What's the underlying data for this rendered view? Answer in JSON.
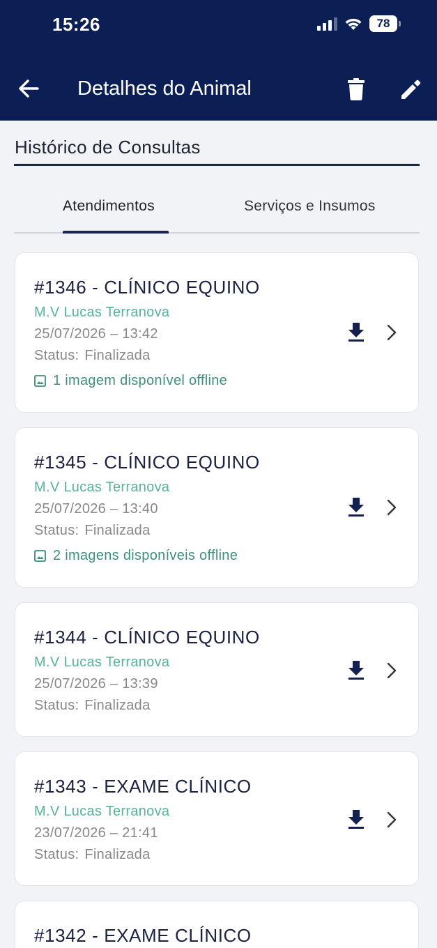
{
  "status_bar": {
    "time": "15:26",
    "battery": "78"
  },
  "header": {
    "title": "Detalhes do Animal",
    "icons": {
      "back": "arrow-left-icon",
      "delete": "trash-icon",
      "edit": "pencil-icon"
    }
  },
  "section": {
    "title": "Histórico de Consultas"
  },
  "tabs": [
    {
      "label": "Atendimentos",
      "active": true
    },
    {
      "label": "Serviços e Insumos",
      "active": false
    }
  ],
  "colors": {
    "header_bg": "#0c1f55",
    "vet_text": "#56b39c",
    "offline_text": "#3e8f7d",
    "accent": "#1a2550"
  },
  "consultations": [
    {
      "title": "#1346 - CLÍNICO EQUINO",
      "vet": "M.V Lucas Terranova",
      "datetime": "25/07/2026 – 13:42",
      "status_label": "Status:",
      "status_value": "Finalizada",
      "offline": "1 imagem disponível offline"
    },
    {
      "title": "#1345 - CLÍNICO EQUINO",
      "vet": "M.V Lucas Terranova",
      "datetime": "25/07/2026 – 13:40",
      "status_label": "Status:",
      "status_value": "Finalizada",
      "offline": "2 imagens disponíveis offline"
    },
    {
      "title": "#1344 - CLÍNICO EQUINO",
      "vet": "M.V Lucas Terranova",
      "datetime": "25/07/2026 – 13:39",
      "status_label": "Status:",
      "status_value": "Finalizada"
    },
    {
      "title": "#1343 - EXAME CLÍNICO",
      "vet": "M.V Lucas Terranova",
      "datetime": "23/07/2026 – 21:41",
      "status_label": "Status:",
      "status_value": "Finalizada"
    },
    {
      "title": "#1342 - EXAME CLÍNICO"
    }
  ]
}
